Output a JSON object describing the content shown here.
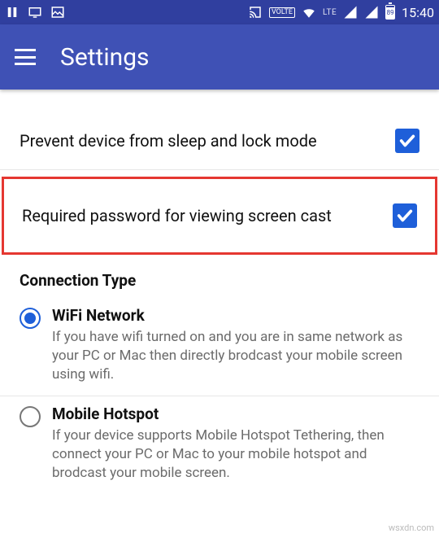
{
  "statusbar": {
    "lte": "LTE",
    "volte": "VOLTE",
    "battery": "89",
    "time": "15:40"
  },
  "appbar": {
    "title": "Settings"
  },
  "settings": {
    "prevent_sleep_label": "Prevent device from sleep and lock mode",
    "require_password_label": "Required password for viewing screen cast"
  },
  "connection": {
    "section_title": "Connection Type",
    "wifi": {
      "title": "WiFi Network",
      "desc": "If you have wifi turned on and you are in same network as your PC or Mac then directly brodcast your mobile screen using wifi."
    },
    "hotspot": {
      "title": "Mobile Hotspot",
      "desc": "If your device supports Mobile Hotspot Tethering, then connect your PC or Mac to your mobile hotspot and brodcast your mobile screen."
    }
  },
  "watermark": "wsxdn.com"
}
